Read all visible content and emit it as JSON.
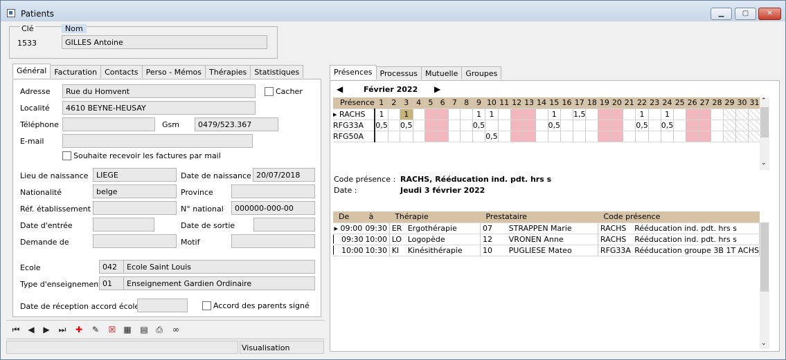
{
  "window": {
    "title": "Patients"
  },
  "header": {
    "key_label": "Clé",
    "name_label": "Nom",
    "key_value": "1533",
    "name_value": "GILLES Antoine"
  },
  "left_tabs": [
    "Général",
    "Facturation",
    "Contacts",
    "Perso - Mémos",
    "Thérapies",
    "Statistiques"
  ],
  "general": {
    "adresse": {
      "label": "Adresse",
      "value": "Rue du Homvent"
    },
    "cacher": {
      "label": "Cacher"
    },
    "localite": {
      "label": "Localité",
      "value": "4610 BEYNE-HEUSAY"
    },
    "telephone": {
      "label": "Téléphone",
      "value": ""
    },
    "gsm": {
      "label": "Gsm",
      "value": "0479/523.367"
    },
    "email": {
      "label": "E-mail",
      "value": ""
    },
    "mail_factures": {
      "label": "Souhaite recevoir les factures par mail"
    },
    "lieu_naissance": {
      "label": "Lieu de naissance",
      "value": "LIEGE"
    },
    "date_naissance": {
      "label": "Date de naissance",
      "value": "20/07/2018"
    },
    "nationalite": {
      "label": "Nationalité",
      "value": "belge"
    },
    "province": {
      "label": "Province",
      "value": ""
    },
    "ref_etablissement": {
      "label": "Réf. établissement",
      "value": ""
    },
    "n_national": {
      "label": "N° national",
      "value": "000000-000-00"
    },
    "date_entree": {
      "label": "Date d'entrée",
      "value": ""
    },
    "date_sortie": {
      "label": "Date de sortie",
      "value": ""
    },
    "demande_de": {
      "label": "Demande de",
      "value": ""
    },
    "motif": {
      "label": "Motif",
      "value": ""
    },
    "ecole": {
      "label": "Ecole",
      "code": "042",
      "value": "Ecole Saint Louis"
    },
    "type_enseignement": {
      "label": "Type d'enseignement",
      "code": "01",
      "value": "Enseignement Gardien Ordinaire"
    },
    "date_reception": {
      "label": "Date de réception accord école",
      "value": ""
    },
    "accord_parents": {
      "label": "Accord des parents signé"
    }
  },
  "status": {
    "left": "",
    "mode": "Visualisation"
  },
  "right_tabs": [
    "Présences",
    "Processus",
    "Mutuelle",
    "Groupes"
  ],
  "presences": {
    "month": "Février 2022",
    "header_label": "Présence",
    "days": [
      "1",
      "2",
      "3",
      "4",
      "5",
      "6",
      "7",
      "8",
      "9",
      "10",
      "11",
      "12",
      "13",
      "14",
      "15",
      "16",
      "17",
      "18",
      "19",
      "20",
      "21",
      "22",
      "23",
      "24",
      "25",
      "26",
      "27",
      "28",
      "29",
      "30",
      "31"
    ],
    "weekend_days": [
      5,
      6,
      12,
      13,
      19,
      20,
      26,
      27
    ],
    "invalid_days": [
      29,
      30,
      31
    ],
    "selected_cell": {
      "row": 0,
      "day": 3
    },
    "rows": [
      {
        "code": "RACHS",
        "values": {
          "1": "1",
          "3": "1",
          "9": "1",
          "10": "1",
          "15": "1",
          "17": "1,5",
          "22": "1",
          "24": "1"
        }
      },
      {
        "code": "RFG33A",
        "values": {
          "1": "0,5",
          "3": "0,5",
          "9": "0,5",
          "15": "0,5",
          "22": "0,5",
          "24": "0,5"
        }
      },
      {
        "code": "RFG50A",
        "values": {
          "10": "0,5"
        }
      }
    ]
  },
  "details": {
    "code_label": "Code présence :",
    "code_value": "RACHS, Rééducation ind. pdt. hrs s",
    "date_label": "Date :",
    "date_value": "Jeudi 3 février 2022"
  },
  "sessions": {
    "headers": [
      "De",
      "à",
      "Thérapie",
      "Prestataire",
      "Code présence"
    ],
    "rows": [
      [
        "09:00",
        "09:30",
        "ER",
        "Ergothérapie",
        "07",
        "STRAPPEN Marie",
        "RACHS",
        "Rééducation ind. pdt. hrs s"
      ],
      [
        "09:30",
        "10:00",
        "LO",
        "Logopède",
        "12",
        "VRONEN Anne",
        "RACHS",
        "Rééducation ind. pdt. hrs s"
      ],
      [
        "10:00",
        "10:30",
        "KI",
        "Kinésithérapie",
        "10",
        "PUGLIESE Mateo",
        "RFG33A",
        "Rééducation groupe 3B 1T ACHS"
      ]
    ]
  },
  "colors": {
    "header_tan": "#d6c3a5",
    "weekend_pink": "#f2b8bd",
    "selected_cell": "#c8b37a"
  }
}
